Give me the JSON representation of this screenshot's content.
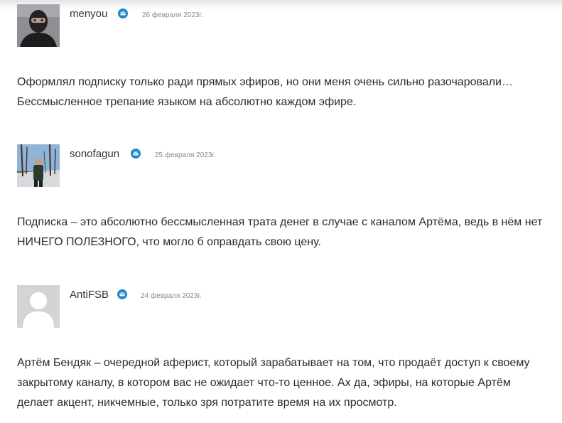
{
  "comments": [
    {
      "author": "menyou",
      "date": "26 февраля 2023г.",
      "avatar": "masked-person-photo",
      "badge_icon": "mail-icon",
      "text": "Оформлял подписку только ради прямых эфиров, но они меня очень сильно разочаровали… Бессмысленное трепание языком на абсолютно каждом эфире."
    },
    {
      "author": "sonofagun",
      "date": "25 февраля 2023г.",
      "avatar": "forest-person-photo",
      "badge_icon": "mail-icon",
      "text": "Подписка – это абсолютно бессмысленная трата денег в случае с каналом Артёма, ведь в нём нет НИЧЕГО ПОЛЕЗНОГО, что могло б оправдать свою цену."
    },
    {
      "author": "AntiFSB",
      "date": "24 февраля 2023г.",
      "avatar": "default-user-placeholder",
      "badge_icon": "mail-icon",
      "text": "Артём Бендяк – очередной аферист, который зарабатывает на том, что продаёт доступ к своему закрытому каналу, в котором вас не ожидает что-то ценное. Ах да, эфиры, на которые Артём делает акцент, никчемные, только зря потратите время на их просмотр."
    }
  ],
  "colors": {
    "badge": "#1e88c9",
    "author": "#333333",
    "date": "#8a8a8a",
    "text": "#2b2b2b"
  }
}
